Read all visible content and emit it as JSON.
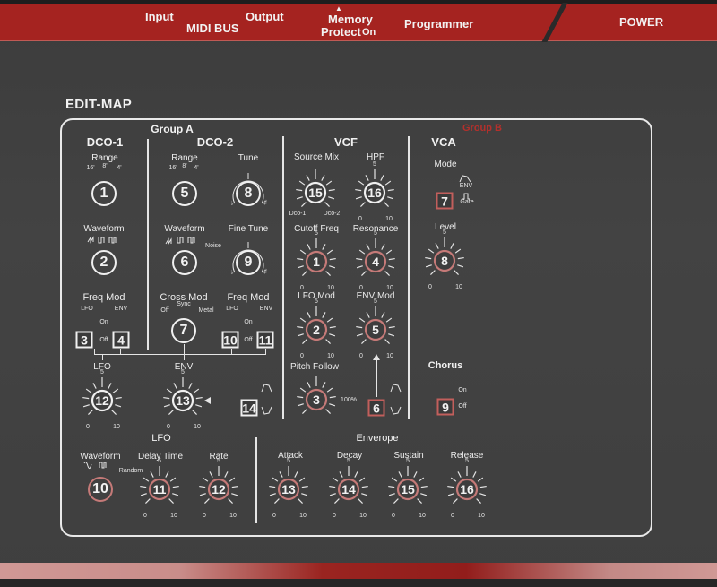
{
  "header": {
    "input": "Input",
    "midi_bus": "MIDI BUS",
    "output": "Output",
    "memory_protect_line1": "Memory",
    "memory_protect_line2": "Protect",
    "memory_protect_state": "On",
    "programmer": "Programmer",
    "power": "POWER",
    "accent_color": "#a52320"
  },
  "title": "EDIT-MAP",
  "groups": {
    "a": "Group A",
    "b": "Group B",
    "b_color": "#b4302c"
  },
  "sections": {
    "dco1": "DCO-1",
    "dco2": "DCO-2",
    "vcf": "VCF",
    "vca": "VCA",
    "lfo_bottom": "LFO",
    "envelope": "Enverope",
    "chorus": "Chorus"
  },
  "dco1": {
    "range_label": "Range",
    "range_options": [
      "16'",
      "8'",
      "4'"
    ],
    "range_knob": "1",
    "waveform_label": "Waveform",
    "waveform_knob": "2",
    "freq_mod_label": "Freq  Mod",
    "lfo": "LFO",
    "env": "ENV",
    "on": "On",
    "off": "Off",
    "lfo_switch": "3",
    "env_switch": "4"
  },
  "dco2": {
    "range_label": "Range",
    "range_options": [
      "16'",
      "8'",
      "4'"
    ],
    "range_knob": "5",
    "tune_label": "Tune",
    "tune_knob": "8",
    "flat": "♭",
    "sharp": "♯",
    "waveform_label": "Waveform",
    "noise": "Noise",
    "waveform_knob": "6",
    "fine_tune_label": "Fine Tune",
    "fine_tune_knob": "9",
    "cross_mod_label": "Cross Mod",
    "cross_off": "Off",
    "cross_sync": "Sync",
    "cross_metal": "Metal",
    "cross_mod_knob": "7",
    "freq_mod_label": "Freq  Mod",
    "lfo": "LFO",
    "env": "ENV",
    "on": "On",
    "off": "Off",
    "lfo_switch": "10",
    "env_switch": "11"
  },
  "mod_sources": {
    "lfo_label": "LFO",
    "lfo_knob": "12",
    "env_label": "ENV",
    "env_knob": "13",
    "env_polarity_switch": "14"
  },
  "vcf": {
    "source_mix_label": "Source  Mix",
    "source_mix_knob": "15",
    "dco1": "Dco-1",
    "dco2": "Dco-2",
    "hpf_label": "HPF",
    "hpf_knob": "16",
    "cutoff_label": "Cutoff Freq",
    "cutoff_knob": "1",
    "resonance_label": "Resonance",
    "resonance_knob": "4",
    "lfo_mod_label": "LFO Mod",
    "lfo_mod_knob": "2",
    "env_mod_label": "ENV  Mod",
    "env_mod_knob": "5",
    "pitch_follow_label": "Pitch  Follow",
    "pitch_follow_knob": "3",
    "pitch_follow_max": "100%",
    "env_polarity_switch": "6"
  },
  "vca": {
    "mode_label": "Mode",
    "env": "ENV",
    "gate": "Gate",
    "mode_switch": "7",
    "level_label": "Level",
    "level_knob": "8"
  },
  "chorus": {
    "on": "On",
    "off": "Off",
    "switch": "9"
  },
  "lfo": {
    "waveform_label": "Waveform",
    "random": "Random",
    "waveform_knob": "10",
    "delay_label": "Delay Time",
    "delay_knob": "11",
    "rate_label": "Rate",
    "rate_knob": "12"
  },
  "env": {
    "attack_label": "Attack",
    "attack_knob": "13",
    "decay_label": "Decay",
    "decay_knob": "14",
    "sustain_label": "Sustain",
    "sustain_knob": "15",
    "release_label": "Release",
    "release_knob": "16"
  },
  "scale": {
    "min": "0",
    "mid": "5",
    "max": "10"
  }
}
